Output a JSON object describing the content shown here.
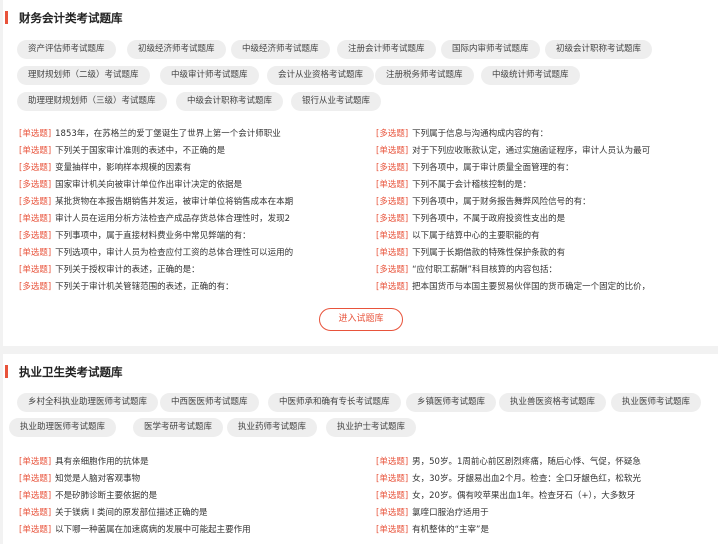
{
  "sections": [
    {
      "title": "财务会计类考试题库",
      "tags": [
        "资产评估师考试题库",
        "初级经济师考试题库",
        "中级经济师考试题库",
        "注册会计师考试题库",
        "国际内审师考试题库",
        "初级会计职称考试题库",
        "理财规划师（二级）考试题库",
        "中级审计师考试题库",
        "会计从业资格考试题库",
        "注册税务师考试题库",
        "中级统计师考试题库",
        "助理理财规划师（三级）考试题库",
        "中级会计职称考试题库",
        "银行从业考试题库"
      ],
      "left_questions": [
        {
          "type": "[单选题]",
          "text": "1853年，在苏格兰的爱丁堡诞生了世界上第一个会计师职业"
        },
        {
          "type": "[单选题]",
          "text": "下列关于国家审计准则的表述中，不正确的是"
        },
        {
          "type": "[多选题]",
          "text": "变量抽样中，影响样本规模的因素有"
        },
        {
          "type": "[多选题]",
          "text": "国家审计机关向被审计单位作出审计决定的依据是"
        },
        {
          "type": "[多选题]",
          "text": "某批货物在本报告期销售并发运，被审计单位将销售成本在本期"
        },
        {
          "type": "[单选题]",
          "text": "审计人员在运用分析方法检查产成品存货总体合理性时，发现2"
        },
        {
          "type": "[多选题]",
          "text": "下列事项中，属于直接材料费业务中常见弊端的有："
        },
        {
          "type": "[单选题]",
          "text": "下列选项中，审计人员为检查应付工资的总体合理性可以运用的"
        },
        {
          "type": "[单选题]",
          "text": "下列关于授权审计的表述，正确的是："
        },
        {
          "type": "[多选题]",
          "text": "下列关于审计机关管辖范围的表述，正确的有："
        }
      ],
      "right_questions": [
        {
          "type": "[多选题]",
          "text": "下列属于信息与沟通构成内容的有："
        },
        {
          "type": "[单选题]",
          "text": "对于下列应收账款认定，通过实施函证程序，审计人员认为最可"
        },
        {
          "type": "[多选题]",
          "text": "下列各项中，属于审计质量全面管理的有："
        },
        {
          "type": "[单选题]",
          "text": "下列不属于会计稽核控制的是："
        },
        {
          "type": "[多选题]",
          "text": "下列各项中，属于财务报告舞弊风险信号的有："
        },
        {
          "type": "[多选题]",
          "text": "下列各项中，不属于政府投资性支出的是"
        },
        {
          "type": "[单选题]",
          "text": "以下属于结算中心的主要职能的有"
        },
        {
          "type": "[单选题]",
          "text": "下列属于长期借款的特殊性保护条款的有"
        },
        {
          "type": "[多选题]",
          "text": "“应付职工薪酬”科目核算的内容包括："
        },
        {
          "type": "[单选题]",
          "text": "把本国货币与本国主要贸易伙伴国的货币确定一个固定的比价，"
        }
      ],
      "button_label": "进入试题库"
    },
    {
      "title": "执业卫生类考试题库",
      "tags": [
        "乡村全科执业助理医师考试题库",
        "中西医医师考试题库",
        "中医师承和确有专长考试题库",
        "乡镇医师考试题库",
        "执业兽医资格考试题库",
        "执业医师考试题库",
        "执业助理医师考试题库",
        "医学考研考试题库",
        "执业药师考试题库",
        "执业护士考试题库"
      ],
      "left_questions": [
        {
          "type": "[单选题]",
          "text": "具有亲细胞作用的抗体是"
        },
        {
          "type": "[单选题]",
          "text": "知觉是人脑对客观事物"
        },
        {
          "type": "[单选题]",
          "text": "不是矽肺诊断主要依据的是"
        },
        {
          "type": "[单选题]",
          "text": "关于镁病 I 类间的原发部位描述正确的是"
        },
        {
          "type": "[单选题]",
          "text": "以下哪一种菌属在加速腐病的发展中可能起主要作用"
        }
      ],
      "right_questions": [
        {
          "type": "[单选题]",
          "text": "男，50岁。1周前心前区剧烈疼痛，随后心悸、气促，怀疑急"
        },
        {
          "type": "[单选题]",
          "text": "女，30岁。牙龈易出血2个月。检查：全口牙龈色红，松软光"
        },
        {
          "type": "[单选题]",
          "text": "女，20岁。偶有咬苹果出血1年。检查牙石（+），大多数牙"
        },
        {
          "type": "[单选题]",
          "text": "氯喹口服治疗适用于"
        },
        {
          "type": "[单选题]",
          "text": "有机整体的“主宰”是"
        }
      ]
    }
  ],
  "colors": {
    "accent": "#e8533b",
    "tag_bg": "#eeeeee",
    "page_bg": "#f2f2f2"
  }
}
